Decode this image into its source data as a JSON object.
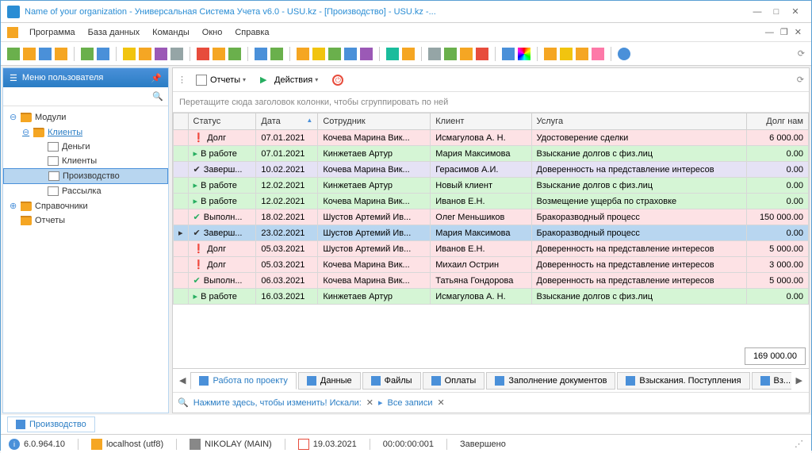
{
  "title": "Name of your organization - Универсальная Система Учета v6.0 - USU.kz - [Производство] - USU.kz -...",
  "menubar": [
    "Программа",
    "База данных",
    "Команды",
    "Окно",
    "Справка"
  ],
  "sidebar": {
    "header": "Меню пользователя",
    "items": [
      {
        "label": "Модули",
        "indent": 0,
        "toggle": "⊖",
        "icon": "folder-open"
      },
      {
        "label": "Клиенты",
        "indent": 1,
        "toggle": "⊖",
        "icon": "folder-open",
        "link": true
      },
      {
        "label": "Деньги",
        "indent": 2,
        "icon": "doc-icon"
      },
      {
        "label": "Клиенты",
        "indent": 2,
        "icon": "doc-icon"
      },
      {
        "label": "Производство",
        "indent": 2,
        "icon": "doc-icon",
        "selected": true
      },
      {
        "label": "Рассылка",
        "indent": 2,
        "icon": "doc-icon"
      },
      {
        "label": "Справочники",
        "indent": 0,
        "toggle": "⊕",
        "icon": "folder-closed"
      },
      {
        "label": "Отчеты",
        "indent": 0,
        "toggle": "",
        "icon": "folder-closed"
      }
    ]
  },
  "panel_toolbar": {
    "reports": "Отчеты",
    "actions": "Действия"
  },
  "group_hint": "Перетащите сюда заголовок колонки, чтобы сгруппировать по ней",
  "grid": {
    "columns": [
      "Статус",
      "Дата",
      "Сотрудник",
      "Клиент",
      "Услуга",
      "Долг нам"
    ],
    "rows": [
      {
        "marker": "",
        "icon": "!",
        "iconcls": "st-red",
        "status": "Долг",
        "date": "07.01.2021",
        "emp": "Кочева Марина Вик...",
        "client": "Исмагулова А. Н.",
        "service": "Удостоверение сделки",
        "debt": "6 000.00",
        "cls": "row-pink"
      },
      {
        "marker": "",
        "icon": "▸",
        "iconcls": "st-green",
        "status": "В работе",
        "date": "07.01.2021",
        "emp": "Кинжетаев Артур",
        "client": "Мария Максимова",
        "service": "Взыскание долгов с физ.лиц",
        "debt": "0.00",
        "cls": "row-green"
      },
      {
        "marker": "",
        "icon": "✔",
        "iconcls": "st-check",
        "status": "Заверш...",
        "date": "10.02.2021",
        "emp": "Кочева Марина Вик...",
        "client": "Герасимов А.И.",
        "service": "Доверенность на представление интересов",
        "debt": "0.00",
        "cls": "row-lav"
      },
      {
        "marker": "",
        "icon": "▸",
        "iconcls": "st-green",
        "status": "В работе",
        "date": "12.02.2021",
        "emp": "Кинжетаев Артур",
        "client": "Новый клиент",
        "service": "Взыскание долгов с физ.лиц",
        "debt": "0.00",
        "cls": "row-green"
      },
      {
        "marker": "",
        "icon": "▸",
        "iconcls": "st-green",
        "status": "В работе",
        "date": "12.02.2021",
        "emp": "Кочева Марина Вик...",
        "client": "Иванов Е.Н.",
        "service": "Возмещение ущерба по страховке",
        "debt": "0.00",
        "cls": "row-green"
      },
      {
        "marker": "",
        "icon": "✔",
        "iconcls": "st-green",
        "status": "Выполн...",
        "date": "18.02.2021",
        "emp": "Шустов Артемий Ив...",
        "client": "Олег Меньшиков",
        "service": "Бракоразводный процесс",
        "debt": "150 000.00",
        "cls": "row-pink"
      },
      {
        "marker": "▸",
        "icon": "✔",
        "iconcls": "st-check",
        "status": "Заверш...",
        "date": "23.02.2021",
        "emp": "Шустов Артемий Ив...",
        "client": "Мария Максимова",
        "service": "Бракоразводный процесс",
        "debt": "0.00",
        "cls": "row-sel"
      },
      {
        "marker": "",
        "icon": "!",
        "iconcls": "st-red",
        "status": "Долг",
        "date": "05.03.2021",
        "emp": "Шустов Артемий Ив...",
        "client": "Иванов Е.Н.",
        "service": "Доверенность на представление интересов",
        "debt": "5 000.00",
        "cls": "row-pink"
      },
      {
        "marker": "",
        "icon": "!",
        "iconcls": "st-red",
        "status": "Долг",
        "date": "05.03.2021",
        "emp": "Кочева Марина Вик...",
        "client": "Михаил Острин",
        "service": "Доверенность на представление интересов",
        "debt": "3 000.00",
        "cls": "row-pink"
      },
      {
        "marker": "",
        "icon": "✔",
        "iconcls": "st-green",
        "status": "Выполн...",
        "date": "06.03.2021",
        "emp": "Кочева Марина Вик...",
        "client": "Татьяна Гондорова",
        "service": "Доверенность на представление интересов",
        "debt": "5 000.00",
        "cls": "row-pink"
      },
      {
        "marker": "",
        "icon": "▸",
        "iconcls": "st-green",
        "status": "В работе",
        "date": "16.03.2021",
        "emp": "Кинжетаев Артур",
        "client": "Исмагулова А. Н.",
        "service": "Взыскание долгов с физ.лиц",
        "debt": "0.00",
        "cls": "row-green"
      }
    ],
    "total": "169 000.00"
  },
  "tabs": [
    "Работа по проекту",
    "Данные",
    "Файлы",
    "Оплаты",
    "Заполнение документов",
    "Взыскания. Поступления",
    "Вз..."
  ],
  "filter": {
    "hint": "Нажмите здесь, чтобы изменить! Искали:",
    "all": "Все записи"
  },
  "child_tab": "Производство",
  "statusbar": {
    "version": "6.0.964.10",
    "host": "localhost (utf8)",
    "user": "NIKOLAY (MAIN)",
    "date": "19.03.2021",
    "time": "00:00:00:001",
    "status": "Завершено"
  }
}
